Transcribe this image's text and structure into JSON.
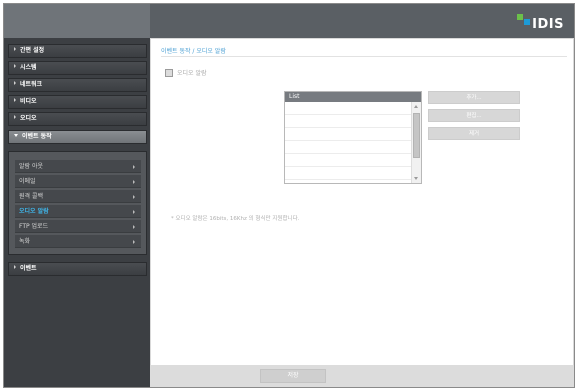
{
  "header": {
    "logo_text": "IDIS",
    "logo_colors": [
      "#6cc04a",
      "#1e9bd7"
    ]
  },
  "sidebar": {
    "menu": [
      {
        "label": "간편 설정"
      },
      {
        "label": "시스템"
      },
      {
        "label": "네트워크"
      },
      {
        "label": "비디오"
      },
      {
        "label": "오디오"
      },
      {
        "label": "이벤트 동작",
        "expanded": true
      }
    ],
    "submenu": [
      {
        "label": "알람 아웃"
      },
      {
        "label": "이메일"
      },
      {
        "label": "원격 콜백"
      },
      {
        "label": "오디오 알람",
        "selected": true
      },
      {
        "label": "FTP 업로드"
      },
      {
        "label": "녹화"
      }
    ],
    "bottom_menu": {
      "label": "이벤트"
    }
  },
  "main": {
    "breadcrumb": "이벤트 동작 / 오디오 알람",
    "audio_alarm_checkbox": {
      "label": "오디오 알람",
      "checked": false
    },
    "list": {
      "header": "List",
      "rows": [
        "",
        "",
        "",
        "",
        "",
        ""
      ]
    },
    "buttons": {
      "add": "추가...",
      "edit": "편집...",
      "delete": "제거"
    },
    "note": "* 오디오 알람은 16bits, 16Khz 의 형식만 지원합니다."
  },
  "footer": {
    "save_label": "저장"
  },
  "colors": {
    "accent": "#3fb6ea",
    "link": "#4a9fd3"
  }
}
